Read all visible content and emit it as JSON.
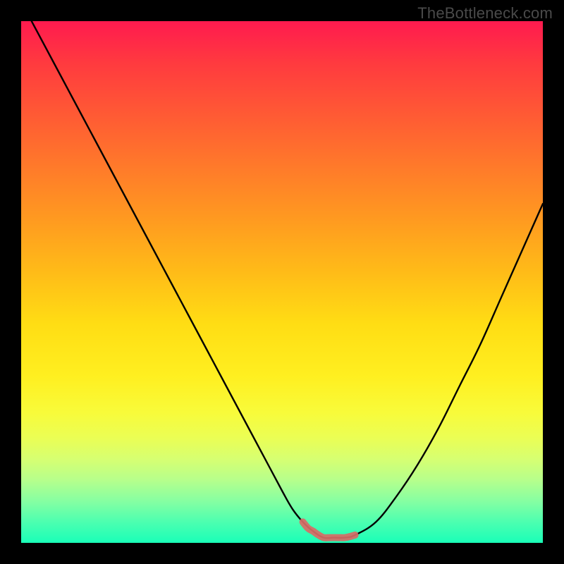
{
  "watermark": "TheBottleneck.com",
  "colors": {
    "curve": "#000000",
    "accent": "#d86b66",
    "background": "#000000"
  },
  "chart_data": {
    "type": "line",
    "title": "",
    "xlabel": "",
    "ylabel": "",
    "xlim": [
      0,
      100
    ],
    "ylim": [
      0,
      100
    ],
    "grid": false,
    "legend": false,
    "annotations": [],
    "x": [
      2,
      6,
      10,
      14,
      18,
      22,
      26,
      30,
      34,
      38,
      42,
      46,
      50,
      52,
      54,
      56,
      58,
      60,
      62,
      64,
      68,
      72,
      76,
      80,
      84,
      88,
      92,
      96,
      100
    ],
    "values": [
      100,
      92.5,
      85,
      77.5,
      70,
      62.5,
      55,
      47.5,
      40,
      32.5,
      25,
      17.5,
      10,
      6.5,
      4,
      2.2,
      1,
      1,
      1,
      1.5,
      4,
      9,
      15,
      22,
      30,
      38,
      47,
      56,
      65
    ],
    "series": [
      {
        "name": "bottleneck-curve",
        "color": "#000000",
        "x": [
          2,
          6,
          10,
          14,
          18,
          22,
          26,
          30,
          34,
          38,
          42,
          46,
          50,
          52,
          54,
          56,
          58,
          60,
          62,
          64,
          68,
          72,
          76,
          80,
          84,
          88,
          92,
          96,
          100
        ],
        "y": [
          100,
          92.5,
          85,
          77.5,
          70,
          62.5,
          55,
          47.5,
          40,
          32.5,
          25,
          17.5,
          10,
          6.5,
          4,
          2.2,
          1,
          1,
          1,
          1.5,
          4,
          9,
          15,
          22,
          30,
          38,
          47,
          56,
          65
        ]
      },
      {
        "name": "optimal-flat-accent",
        "color": "#d86b66",
        "x": [
          54,
          55,
          56,
          57,
          58,
          59,
          60,
          61,
          62,
          63,
          64
        ],
        "y": [
          4,
          2.8,
          2.2,
          1.5,
          1,
          1,
          1,
          1,
          1,
          1.2,
          1.5
        ]
      }
    ]
  }
}
